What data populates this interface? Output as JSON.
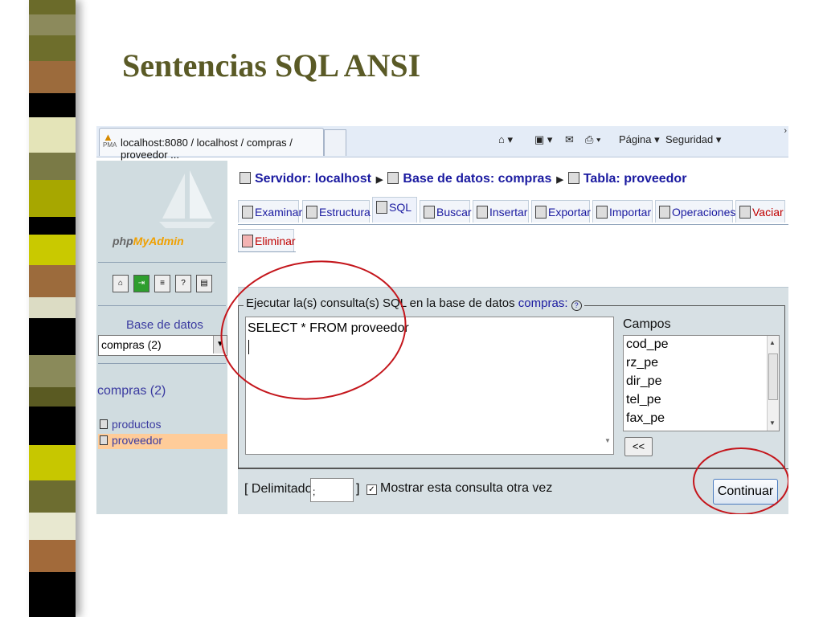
{
  "slide_title": "Sentencias SQL ANSI",
  "browser": {
    "tab_title": "localhost:8080 / localhost / compras / proveedor ...",
    "favicon_text": "PMA",
    "tools": {
      "page": "Página ▾",
      "security": "Seguridad ▾"
    }
  },
  "sidebar": {
    "logo": {
      "prefix": "php",
      "suffix": "MyAdmin"
    },
    "db_label": "Base de datos",
    "db_select": "compras (2)",
    "db_name": "compras (2)",
    "tables": [
      {
        "name": "productos",
        "selected": false
      },
      {
        "name": "proveedor",
        "selected": true
      }
    ]
  },
  "breadcrumb": {
    "server": "Servidor: localhost",
    "database": "Base de datos: compras",
    "table": "Tabla: proveedor"
  },
  "tabs": [
    "Examinar",
    "Estructura",
    "SQL",
    "Buscar",
    "Insertar",
    "Exportar",
    "Importar",
    "Operaciones",
    "Vaciar"
  ],
  "tab_active": "SQL",
  "tab_delete": "Eliminar",
  "query_form": {
    "legend_prefix": "Ejecutar la(s) consulta(s) SQL en la base de datos",
    "legend_db": "compras:",
    "sql_value": "SELECT * FROM proveedor",
    "fields_label": "Campos",
    "fields": [
      "cod_pe",
      "rz_pe",
      "dir_pe",
      "tel_pe",
      "fax_pe"
    ],
    "insert_button": "<<"
  },
  "bottom": {
    "delimiter_label": "[ Delimitador",
    "delimiter_value": ";",
    "delimiter_close": "]",
    "show_again_label": "Mostrar esta consulta otra vez",
    "show_again_checked": true,
    "continue_button": "Continuar"
  },
  "colors": {
    "title": "#5a5a26",
    "link": "#1a1aa0",
    "annotation": "#c4161c"
  }
}
